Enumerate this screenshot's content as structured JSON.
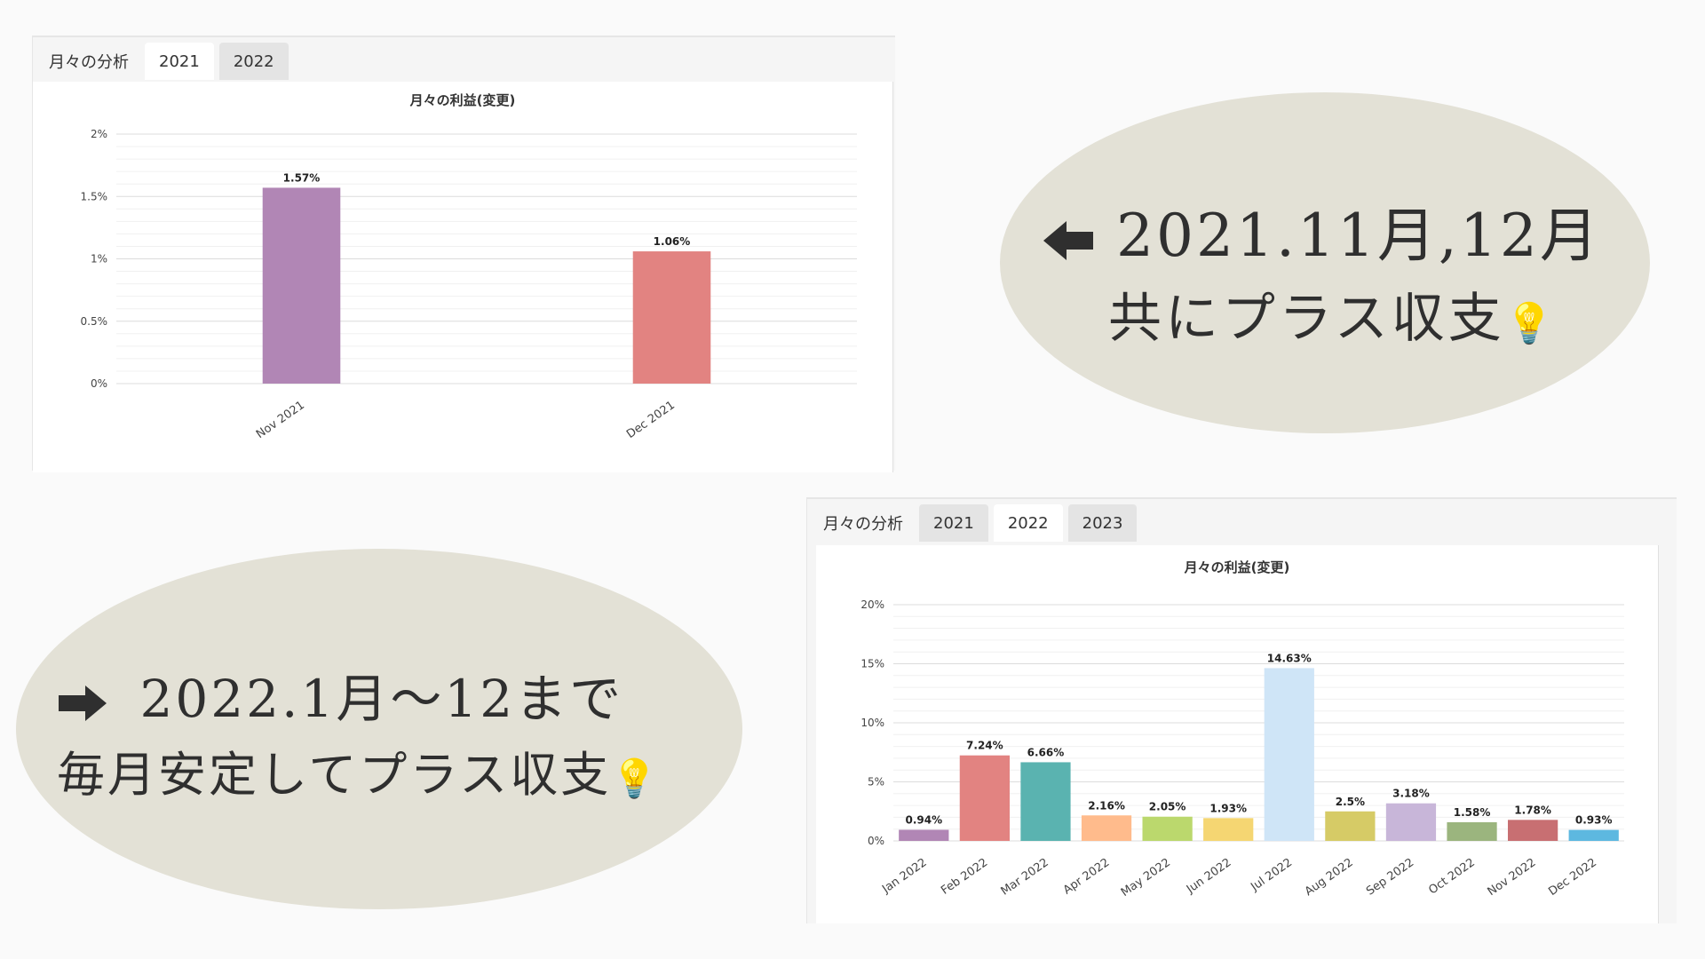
{
  "top_panel": {
    "tabs": [
      {
        "label": "月々の分析",
        "state": "label"
      },
      {
        "label": "2021",
        "state": "active"
      },
      {
        "label": "2022",
        "state": "inactive"
      }
    ],
    "chart_data": {
      "type": "bar",
      "title": "月々の利益(変更)",
      "categories": [
        "Nov 2021",
        "Dec 2021"
      ],
      "values": [
        1.57,
        1.06
      ],
      "data_labels": [
        "1.57%",
        "1.06%"
      ],
      "colors": [
        "#b186b5",
        "#e28381"
      ],
      "ylim": [
        0,
        2
      ],
      "yticks": [
        0,
        0.5,
        1,
        1.5,
        2
      ],
      "ytick_labels": [
        "0%",
        "0.5%",
        "1%",
        "1.5%",
        "2%"
      ],
      "grid": true,
      "legend": "none"
    }
  },
  "bottom_panel": {
    "tabs": [
      {
        "label": "月々の分析",
        "state": "label"
      },
      {
        "label": "2021",
        "state": "inactive"
      },
      {
        "label": "2022",
        "state": "active"
      },
      {
        "label": "2023",
        "state": "inactive"
      }
    ],
    "chart_data": {
      "type": "bar",
      "title": "月々の利益(変更)",
      "categories": [
        "Jan 2022",
        "Feb 2022",
        "Mar 2022",
        "Apr 2022",
        "May 2022",
        "Jun 2022",
        "Jul 2022",
        "Aug 2022",
        "Sep 2022",
        "Oct 2022",
        "Nov 2022",
        "Dec 2022"
      ],
      "values": [
        0.94,
        7.24,
        6.66,
        2.16,
        2.05,
        1.93,
        14.63,
        2.5,
        3.18,
        1.58,
        1.78,
        0.93
      ],
      "data_labels": [
        "0.94%",
        "7.24%",
        "6.66%",
        "2.16%",
        "2.05%",
        "1.93%",
        "14.63%",
        "2.5%",
        "3.18%",
        "1.58%",
        "1.78%",
        "0.93%"
      ],
      "colors": [
        "#b186b5",
        "#e28381",
        "#5ab3b0",
        "#ffbb8c",
        "#bbd86d",
        "#f5d672",
        "#cfe5f7",
        "#d6cb66",
        "#c8b6d9",
        "#9bb57e",
        "#c86f72",
        "#5db8e0"
      ],
      "ylim": [
        0,
        20
      ],
      "yticks": [
        0,
        5,
        10,
        15,
        20
      ],
      "ytick_labels": [
        "0%",
        "5%",
        "10%",
        "15%",
        "20%"
      ],
      "grid": true,
      "legend": "none"
    }
  },
  "callout_top": {
    "arrow": "left-arrow-icon",
    "line1": "2021.11月,12月",
    "line2": "共にプラス収支",
    "emoji": "💡"
  },
  "callout_bottom": {
    "arrow": "right-arrow-icon",
    "line1": "2022.1月〜12まで",
    "line2": "毎月安定してプラス収支",
    "emoji": "💡"
  },
  "colors": {
    "background": "#fafafa",
    "bubble": "#e3e1d6",
    "text": "#2f2f2f"
  }
}
